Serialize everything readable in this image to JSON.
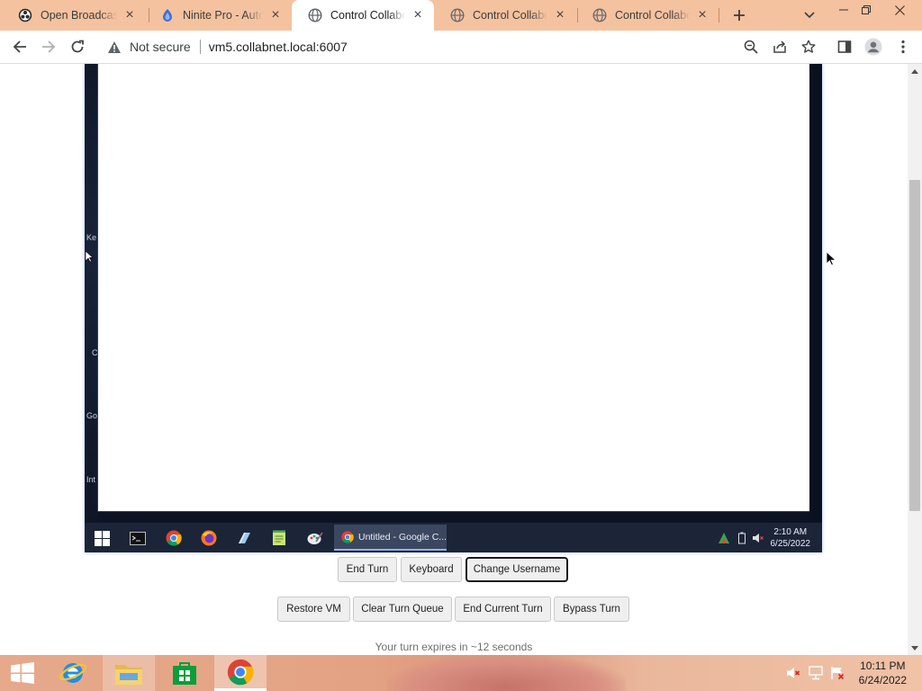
{
  "browser": {
    "tabs": [
      {
        "title": "Open Broadcaster",
        "favicon": "obs-icon",
        "active": false
      },
      {
        "title": "Ninite Pro - Automate",
        "favicon": "ninite-icon",
        "active": false
      },
      {
        "title": "Control Collaboration",
        "favicon": "globe-icon",
        "active": true
      },
      {
        "title": "Control Collaboration",
        "favicon": "globe-icon",
        "active": false
      },
      {
        "title": "Control Collaboration",
        "favicon": "globe-icon",
        "active": false
      }
    ],
    "security_label": "Not secure",
    "url": "vm5.collabnet.local:6007"
  },
  "vm": {
    "ghost_labels": [
      "Ke",
      "C",
      "Go",
      "Int"
    ],
    "taskbar_window_label": "Untitled - Google C...",
    "clock_time": "2:10 AM",
    "clock_date": "6/25/2022"
  },
  "controls": {
    "primary": [
      "End Turn",
      "Keyboard",
      "Change Username"
    ],
    "secondary": [
      "Restore VM",
      "Clear Turn Queue",
      "End Current Turn",
      "Bypass Turn"
    ],
    "status": "Your turn expires in ~12 seconds"
  },
  "host": {
    "clock_time": "10:11 PM",
    "clock_date": "6/24/2022"
  },
  "colors": {
    "tabstrip": "#f4c29f",
    "vm_taskbar": "#1c2438"
  }
}
